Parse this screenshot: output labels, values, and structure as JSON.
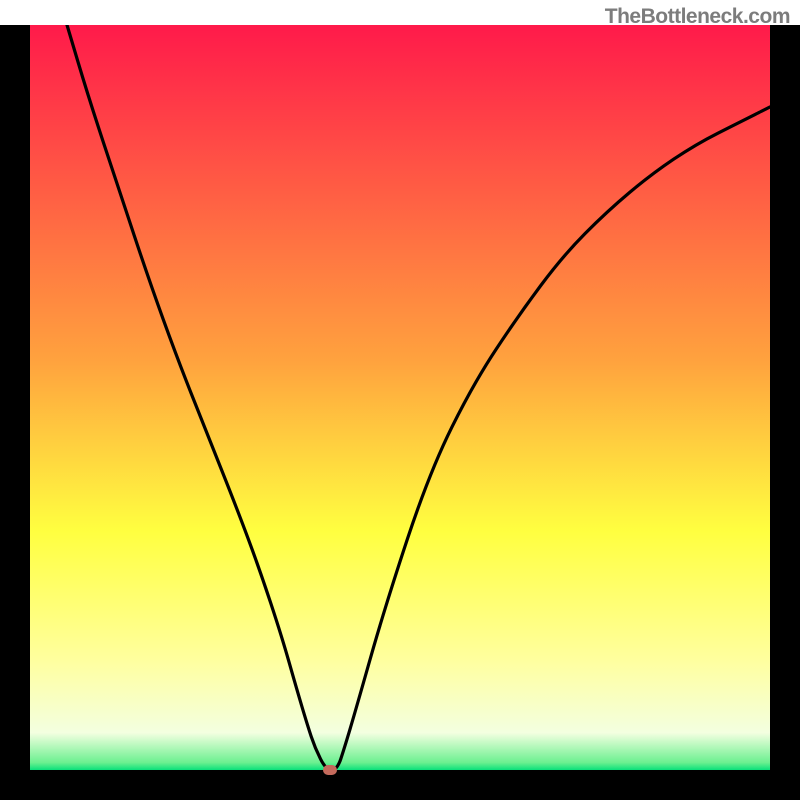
{
  "attribution": "TheBottleneck.com",
  "chart_data": {
    "type": "line",
    "title": "",
    "xlabel": "",
    "ylabel": "",
    "xlim": [
      0,
      100
    ],
    "ylim": [
      0,
      100
    ],
    "background_gradient": [
      {
        "pos": 0,
        "color": "#ff1a4a"
      },
      {
        "pos": 45,
        "color": "#ffa23e"
      },
      {
        "pos": 68,
        "color": "#ffff40"
      },
      {
        "pos": 85,
        "color": "#ffff9d"
      },
      {
        "pos": 95,
        "color": "#f3ffe0"
      },
      {
        "pos": 99,
        "color": "#6cf090"
      },
      {
        "pos": 100,
        "color": "#09e07a"
      }
    ],
    "frame_color": "#000000",
    "series": [
      {
        "name": "bottleneck-curve",
        "color": "#000000",
        "x": [
          5,
          8,
          12,
          16,
          20,
          24,
          28,
          31,
          34,
          36,
          37.5,
          38.5,
          40,
          41.5,
          42.5,
          44,
          48,
          54,
          60,
          66,
          72,
          78,
          84,
          90,
          96,
          100
        ],
        "y": [
          100,
          90,
          78,
          66,
          55,
          45,
          35,
          27,
          18,
          11,
          6,
          3,
          0,
          0,
          3,
          8,
          22,
          40,
          52,
          61,
          69,
          75,
          80,
          84,
          87,
          89
        ]
      }
    ],
    "marker": {
      "x": 40.5,
      "y": 0,
      "color": "#c46a5c"
    }
  }
}
